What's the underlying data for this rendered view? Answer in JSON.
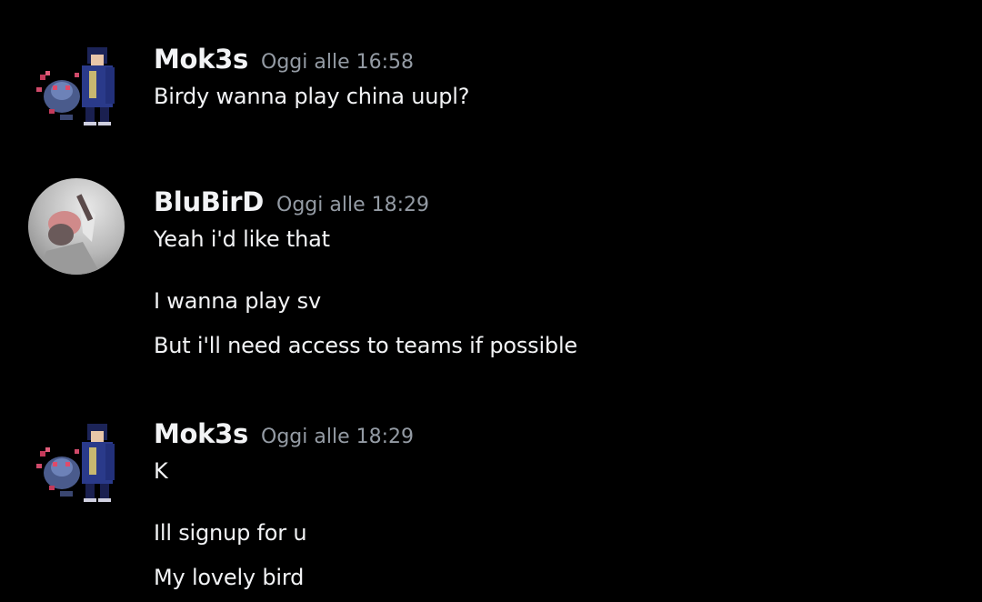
{
  "messages": [
    {
      "author": "Mok3s",
      "timestamp": "Oggi alle 16:58",
      "avatar_icon": "pixel-character-with-pokemon-avatar",
      "lines": [
        "Birdy wanna play china uupl?"
      ]
    },
    {
      "author": "BluBirD",
      "timestamp": "Oggi alle 18:29",
      "avatar_icon": "blurred-photo-avatar",
      "lines": [
        "Yeah i'd like that",
        "I wanna play sv",
        "But i'll need access to teams if possible"
      ]
    },
    {
      "author": "Mok3s",
      "timestamp": "Oggi alle 18:29",
      "avatar_icon": "pixel-character-with-pokemon-avatar",
      "lines": [
        "K",
        "Ill signup for u",
        "My lovely bird"
      ]
    }
  ],
  "colors": {
    "background": "#000000",
    "username": "#f2f3f5",
    "timestamp": "#949ba4",
    "message_text": "#f2f3f5"
  }
}
